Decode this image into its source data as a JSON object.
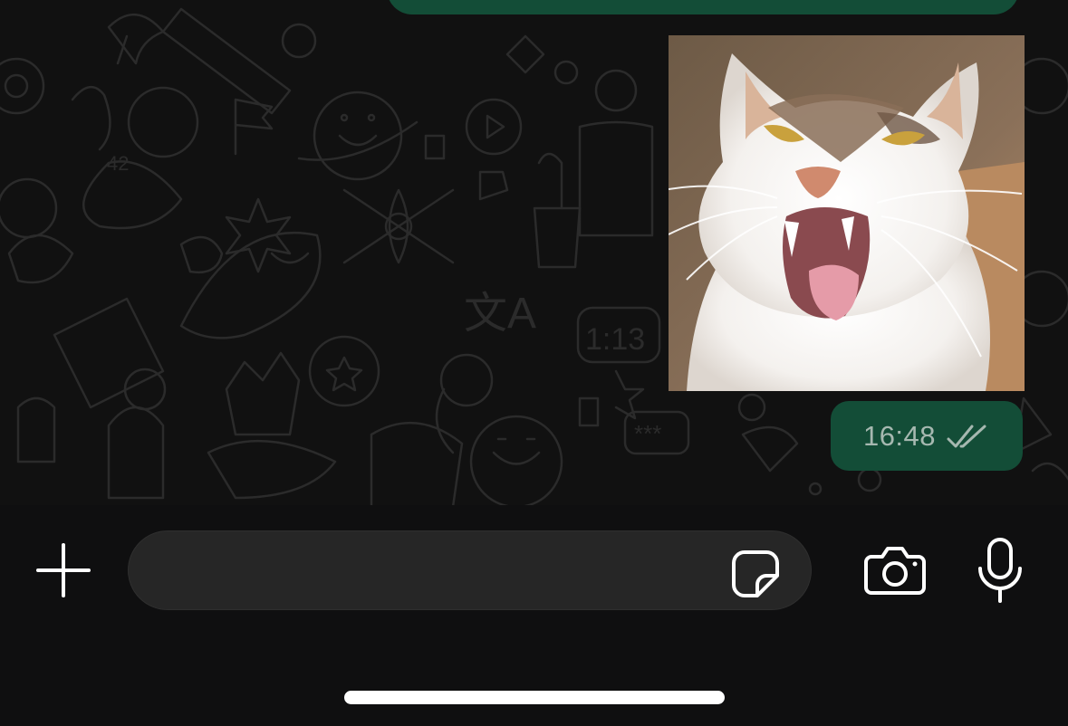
{
  "message": {
    "time": "16:48",
    "status_icon": "double-check-icon",
    "sticker": "cat-sticker"
  },
  "input": {
    "placeholder": "",
    "value": ""
  },
  "icons": {
    "attach": "plus-icon",
    "sticker": "sticker-icon",
    "camera": "camera-icon",
    "mic": "microphone-icon"
  },
  "colors": {
    "bubble": "#134d37",
    "background": "#111111",
    "input_bar": "#0f0f10",
    "input_field": "#262626"
  }
}
